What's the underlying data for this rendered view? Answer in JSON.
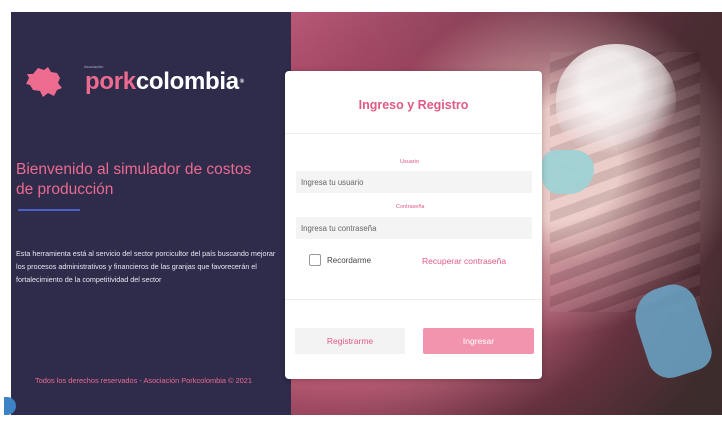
{
  "brand": {
    "assoc": "Asociación",
    "name_part1": "pork",
    "name_part2": "colombia",
    "trademark": "®"
  },
  "left_panel": {
    "welcome": "Bienvenido al simulador de costos de producción",
    "description": "Esta herramienta está al servicio del sector porcicultor del país buscando mejorar los procesos administrativos y financieros de las granjas que favorecerán el fortalecimiento de la competitividad del sector",
    "copyright": "Todos los derechos reservados - Asociación Porkcolombia © 2021"
  },
  "form": {
    "title": "Ingreso y Registro",
    "user_label": "Usuario",
    "user_placeholder": "Ingresa tu usuario",
    "user_value": "",
    "password_label": "Contraseña",
    "password_placeholder": "Ingresa tu contraseña",
    "password_value": "",
    "remember_label": "Recordarme",
    "remember_checked": false,
    "recover_link": "Recuperar contraseña",
    "register_button": "Registrarme",
    "login_button": "Ingresar"
  },
  "colors": {
    "panel_bg": "#2e2b4b",
    "accent_pink": "#ec6b8f",
    "button_pink": "#f294ae",
    "rule_blue": "#4c5fc4"
  },
  "icons": {
    "logo": "colombia-map-pig-logo"
  }
}
